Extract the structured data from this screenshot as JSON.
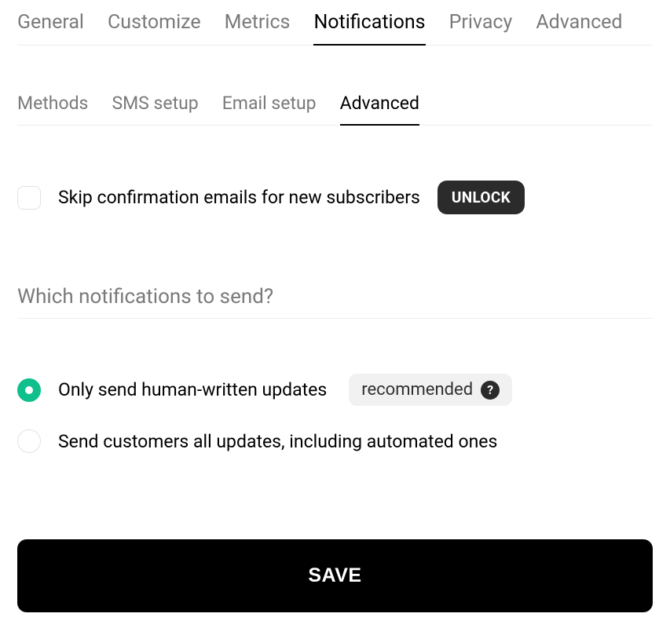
{
  "tabs": {
    "primary": [
      {
        "label": "General",
        "active": false
      },
      {
        "label": "Customize",
        "active": false
      },
      {
        "label": "Metrics",
        "active": false
      },
      {
        "label": "Notifications",
        "active": true
      },
      {
        "label": "Privacy",
        "active": false
      },
      {
        "label": "Advanced",
        "active": false
      }
    ],
    "secondary": [
      {
        "label": "Methods",
        "active": false
      },
      {
        "label": "SMS setup",
        "active": false
      },
      {
        "label": "Email setup",
        "active": false
      },
      {
        "label": "Advanced",
        "active": true
      }
    ]
  },
  "skip_confirmation": {
    "label": "Skip confirmation emails for new subscribers",
    "checked": false,
    "unlock_label": "UNLOCK"
  },
  "section": {
    "heading": "Which notifications to send?"
  },
  "radio_options": {
    "option1": {
      "label": "Only send human-written updates",
      "selected": true,
      "badge": "recommended",
      "help": "?"
    },
    "option2": {
      "label": "Send customers all updates, including automated ones",
      "selected": false
    }
  },
  "save_button": {
    "label": "SAVE"
  }
}
